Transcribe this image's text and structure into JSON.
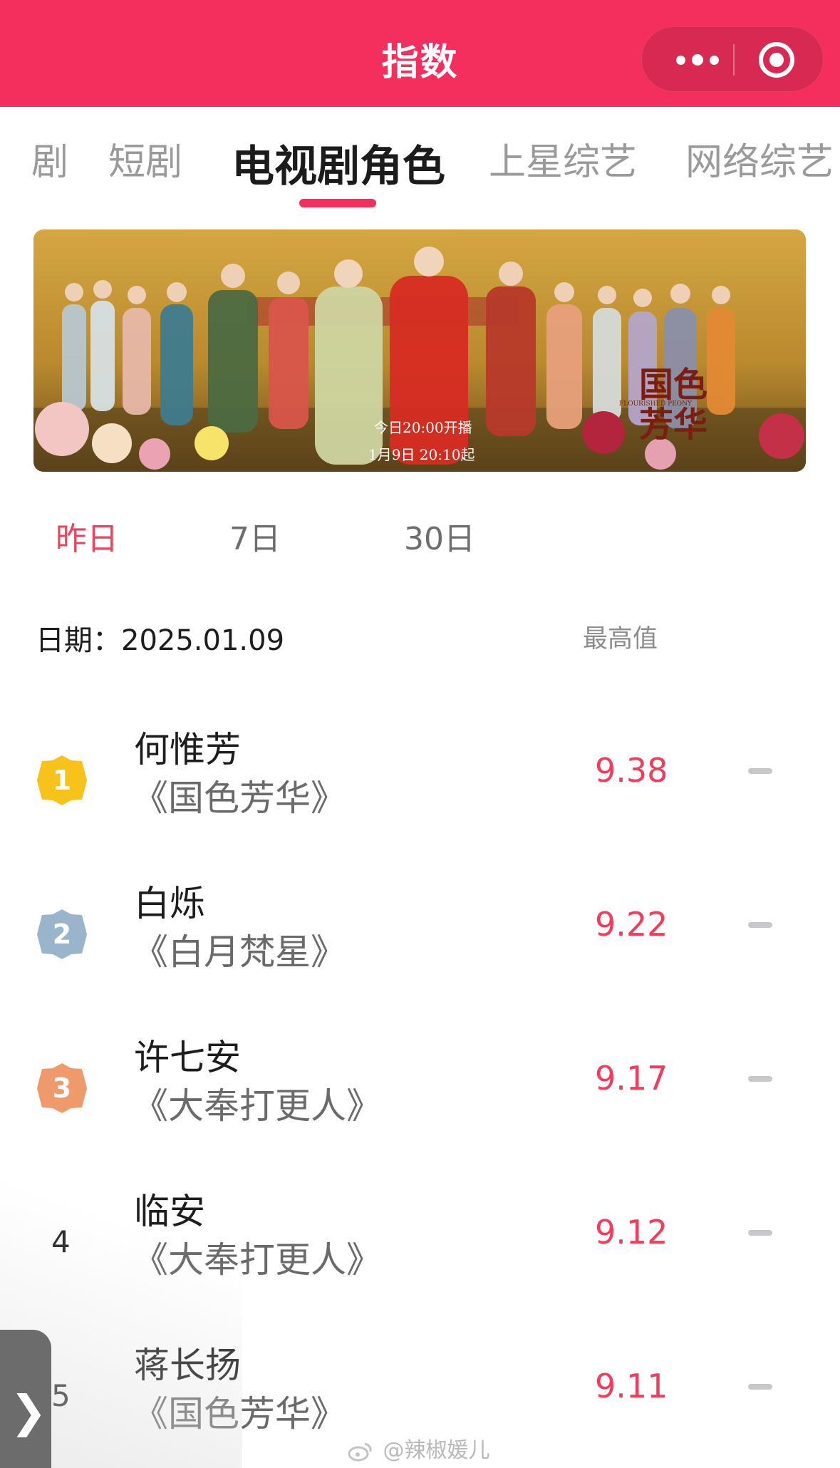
{
  "header": {
    "title": "指数",
    "bg_color": "#f52f5d"
  },
  "tabs": [
    {
      "label": "剧"
    },
    {
      "label": "短剧"
    },
    {
      "label": "电视剧角色",
      "active": true
    },
    {
      "label": "上星综艺"
    },
    {
      "label": "网络综艺"
    }
  ],
  "banner": {
    "logo_text": "国色芳华",
    "logo_subtitle": "FLOURISHED PEONY",
    "air_line1": "今日20:00开播",
    "air_line2": "1月9日 20:10起"
  },
  "periods": [
    {
      "label": "昨日",
      "active": true
    },
    {
      "label": "7日"
    },
    {
      "label": "30日"
    }
  ],
  "date": {
    "label": "日期：",
    "value": "2025.01.09",
    "max_label": "最高值"
  },
  "rankings": [
    {
      "rank": "1",
      "name": "何惟芳",
      "show": "《国色芳华》",
      "score": "9.38",
      "badge": "gold"
    },
    {
      "rank": "2",
      "name": "白烁",
      "show": "《白月梵星》",
      "score": "9.22",
      "badge": "silver"
    },
    {
      "rank": "3",
      "name": "许七安",
      "show": "《大奉打更人》",
      "score": "9.17",
      "badge": "bronze"
    },
    {
      "rank": "4",
      "name": "临安",
      "show": "《大奉打更人》",
      "score": "9.12"
    },
    {
      "rank": "5",
      "name": "蒋长扬",
      "show": "《国色芳华》",
      "score": "9.11"
    }
  ],
  "float_button": {
    "glyph": "❯"
  },
  "watermark": {
    "text": "@辣椒媛儿"
  },
  "colors": {
    "accent": "#f52f5d",
    "score": "#ef3d5b",
    "gold": "#f7c21a",
    "silver": "#9ab4cc",
    "bronze": "#ee9a6a"
  }
}
